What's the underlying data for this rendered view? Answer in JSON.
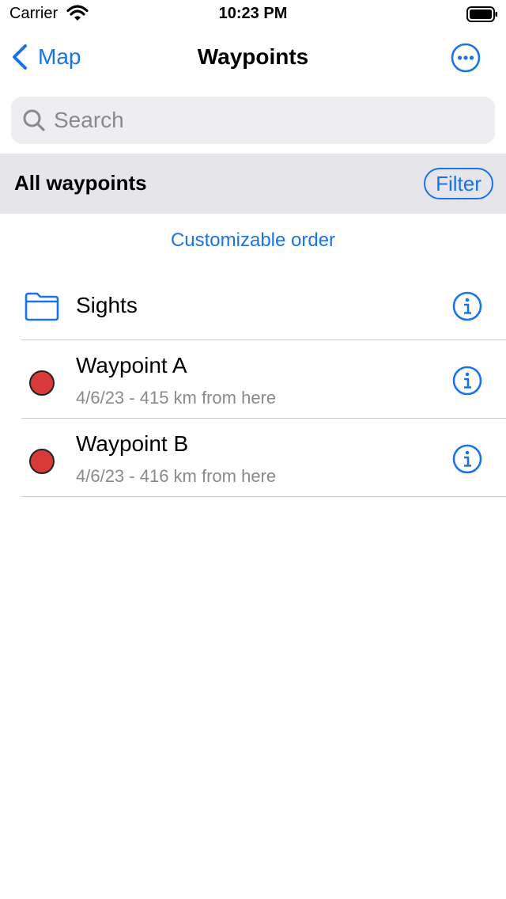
{
  "status_bar": {
    "carrier": "Carrier",
    "time": "10:23 PM",
    "icons": [
      "wifi-icon",
      "battery-icon"
    ]
  },
  "nav": {
    "back_label": "Map",
    "title": "Waypoints",
    "back_icon": "chevron-left-icon",
    "more_icon": "ellipsis-circle-icon"
  },
  "search": {
    "placeholder": "Search",
    "value": "",
    "icon": "magnifying-glass-icon"
  },
  "section": {
    "title": "All waypoints",
    "filter_label": "Filter"
  },
  "order_link": "Customizable order",
  "list": [
    {
      "type": "folder",
      "icon": "folder-icon",
      "title": "Sights",
      "subtitle": ""
    },
    {
      "type": "waypoint",
      "icon": "red-dot-icon",
      "title": "Waypoint A",
      "subtitle": "4/6/23 - 415 km from here"
    },
    {
      "type": "waypoint",
      "icon": "red-dot-icon",
      "title": "Waypoint B",
      "subtitle": "4/6/23 - 416 km from here"
    }
  ],
  "colors": {
    "accent": "#1a73e8",
    "header_bg": "#e5e5ea",
    "search_bg": "#eeeef0",
    "secondary_text": "#8a8a8e",
    "waypoint_dot": "#d83a3a"
  }
}
